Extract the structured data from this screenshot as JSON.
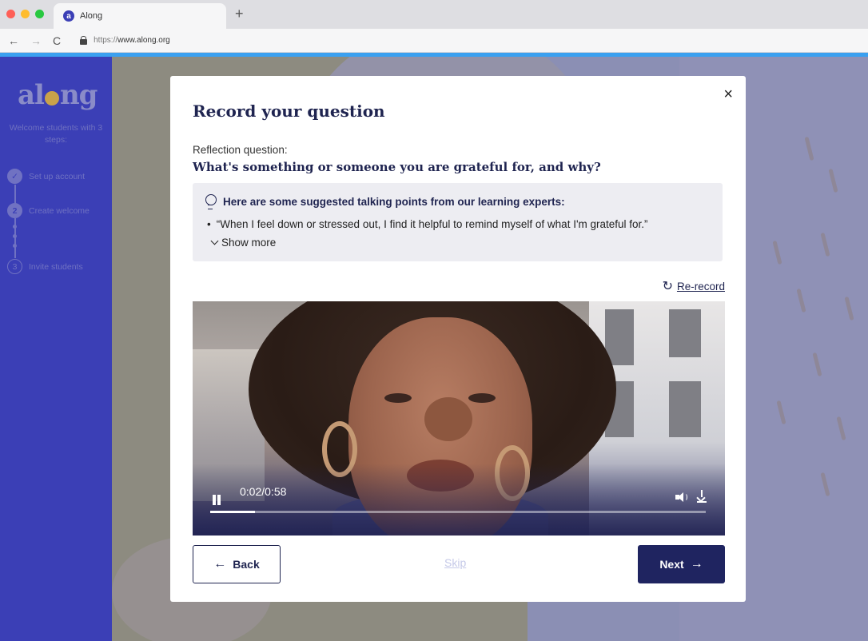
{
  "browser": {
    "tab_title": "Along",
    "tab_favicon_letter": "a",
    "new_tab_symbol": "+",
    "url_protocol": "https://",
    "url_host": "www.along.org",
    "back_icon": "←",
    "forward_icon": "→",
    "reload_icon": "C"
  },
  "sidebar": {
    "logo_left": "al",
    "logo_right": "ng",
    "welcome": "Welcome students with 3 steps:",
    "steps": [
      {
        "number": "✓",
        "label": "Set up account"
      },
      {
        "number": "2",
        "label": "Create welcome"
      },
      {
        "number": "3",
        "label": "Invite students"
      }
    ]
  },
  "modal": {
    "close_icon": "×",
    "title": "Record your question",
    "question_label": "Reflection question:",
    "question_text": "What's something or someone you are grateful for, and why?",
    "tips_heading": "Here are some suggested talking points from our learning experts:",
    "tip": "“When I feel down or stressed out, I find it helpful to remind myself of what I'm grateful for.”",
    "bullet": "•",
    "show_more": "Show more",
    "rerecord_icon": "↻",
    "rerecord": "Re-record",
    "video": {
      "time": "0:02/0:58",
      "progress": 0.09
    },
    "back_arrow": "←",
    "back": "Back",
    "skip": "Skip",
    "next": "Next",
    "next_arrow": "→"
  },
  "colors": {
    "brand": "#3b3fb6",
    "navy": "#1f2450",
    "accent_bar": "#3aa0f0"
  }
}
